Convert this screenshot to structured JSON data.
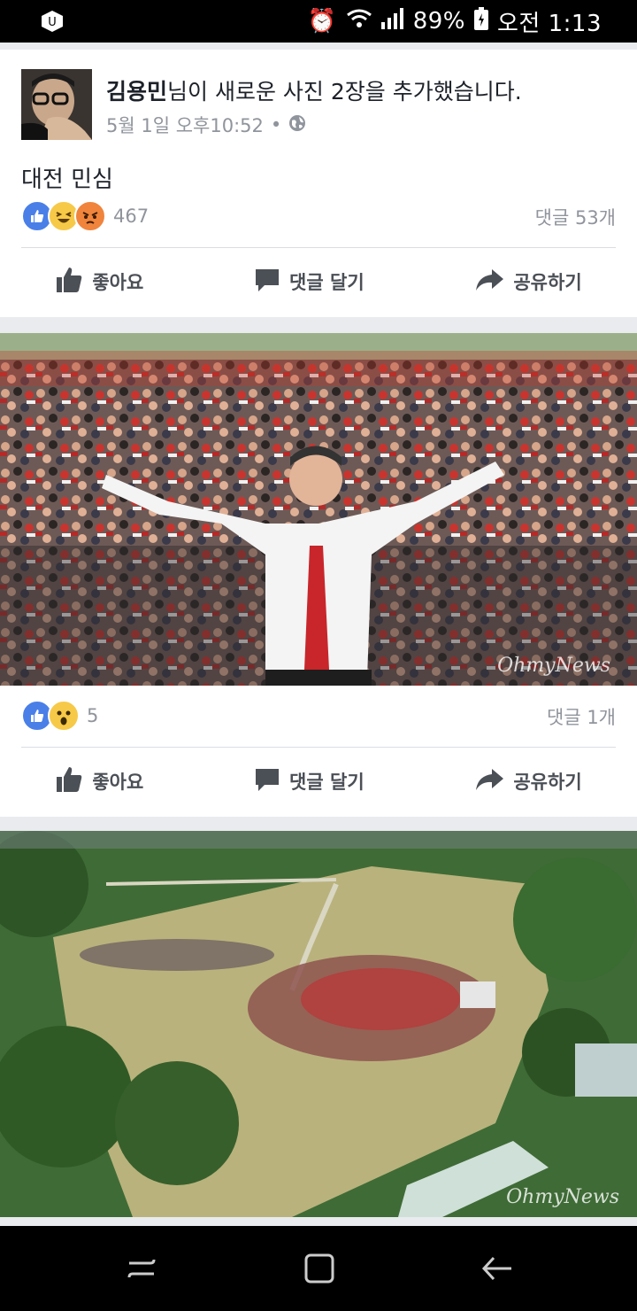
{
  "status_bar": {
    "battery": "89%",
    "time": "오전 1:13"
  },
  "post": {
    "author": "김용민",
    "headline_suffix": "님이 새로운 사진 2장을 추가했습니다.",
    "timestamp": "5월 1일 오후10:52",
    "separator": "•",
    "privacy_icon": "globe-icon",
    "text": "대전 민심",
    "reaction_count": "467",
    "comment_count": "댓글 53개"
  },
  "actions": {
    "like": "좋아요",
    "comment": "댓글 달기",
    "share": "공유하기"
  },
  "photo1": {
    "watermark": "OhmyNews",
    "reaction_count": "5",
    "comment_count": "댓글 1개"
  },
  "photo2": {
    "watermark": "OhmyNews"
  },
  "colors": {
    "like_blue": "#4a7fe8",
    "divider": "#dadde1",
    "meta_gray": "#90949c"
  }
}
